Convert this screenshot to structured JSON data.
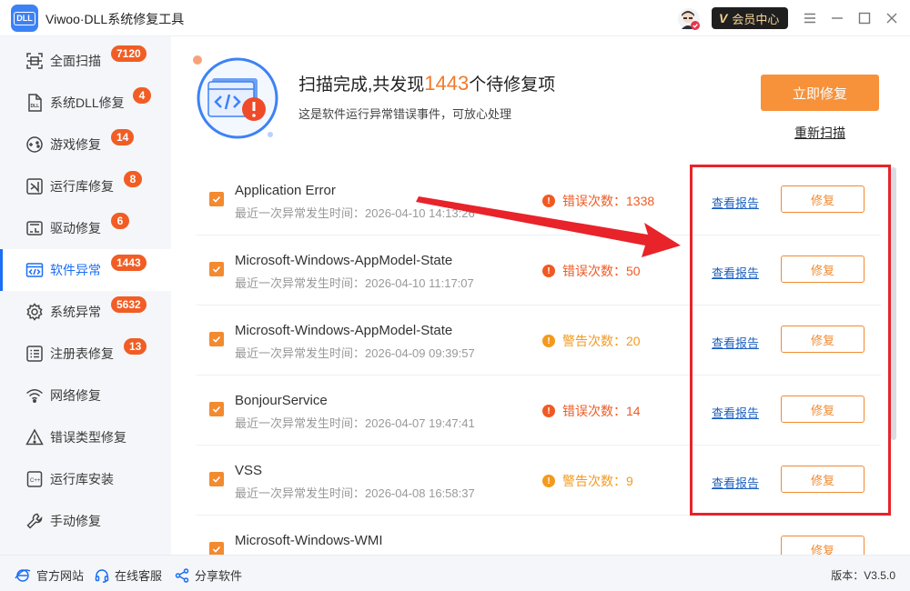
{
  "app": {
    "logo_text": "DLL",
    "title": "Viwoo·DLL系统修复工具",
    "vip_label": "会员中心",
    "vip_mark": "V"
  },
  "sidebar": {
    "items": [
      {
        "label": "全面扫描",
        "badge": "7120",
        "icon": "scan-icon"
      },
      {
        "label": "系统DLL修复",
        "badge": "4",
        "icon": "dll-file-icon"
      },
      {
        "label": "游戏修复",
        "badge": "14",
        "icon": "gamepad-icon"
      },
      {
        "label": "运行库修复",
        "badge": "8",
        "icon": "vs-runtime-icon"
      },
      {
        "label": "驱动修复",
        "badge": "6",
        "icon": "driver-chip-icon"
      },
      {
        "label": "软件异常",
        "badge": "1443",
        "icon": "code-window-icon",
        "active": true
      },
      {
        "label": "系统异常",
        "badge": "5632",
        "icon": "gear-icon"
      },
      {
        "label": "注册表修复",
        "badge": "13",
        "icon": "registry-list-icon"
      },
      {
        "label": "网络修复",
        "badge": "",
        "icon": "wifi-icon"
      },
      {
        "label": "错误类型修复",
        "badge": "",
        "icon": "warning-triangle-icon"
      },
      {
        "label": "运行库安装",
        "badge": "",
        "icon": "cpp-file-icon"
      },
      {
        "label": "手动修复",
        "badge": "",
        "icon": "wrench-icon"
      }
    ]
  },
  "header": {
    "title_prefix": "扫描完成,共发现",
    "count": "1443",
    "title_suffix": "个待修复项",
    "subtitle": "这是软件运行异常错误事件，可放心处理",
    "fix_all_label": "立即修复",
    "rescan_label": "重新扫描"
  },
  "list": {
    "report_label": "查看报告",
    "fix_label": "修复",
    "rows": [
      {
        "name": "Application Error",
        "time": "最近一次异常发生时间：2026-04-10 14:13:26",
        "count_label": "错误次数：1338",
        "level": "err"
      },
      {
        "name": "Microsoft-Windows-AppModel-State",
        "time": "最近一次异常发生时间：2026-04-10 11:17:07",
        "count_label": "错误次数：50",
        "level": "err"
      },
      {
        "name": "Microsoft-Windows-AppModel-State",
        "time": "最近一次异常发生时间：2026-04-09 09:39:57",
        "count_label": "警告次数：20",
        "level": "warn"
      },
      {
        "name": "BonjourService",
        "time": "最近一次异常发生时间：2026-04-07 19:47:41",
        "count_label": "错误次数：14",
        "level": "err"
      },
      {
        "name": "VSS",
        "time": "最近一次异常发生时间：2026-04-08 16:58:37",
        "count_label": "警告次数：9",
        "level": "warn"
      },
      {
        "name": "Microsoft-Windows-WMI",
        "time": "",
        "count_label": "",
        "level": "err"
      }
    ]
  },
  "footer": {
    "website": "官方网站",
    "support": "在线客服",
    "share": "分享软件",
    "version": "版本：V3.5.0"
  },
  "colors": {
    "accent": "#1c6ef2",
    "orange": "#f28a30",
    "error": "#ef5a24",
    "warning": "#f39a1e",
    "annotation_red": "#e8232a"
  }
}
